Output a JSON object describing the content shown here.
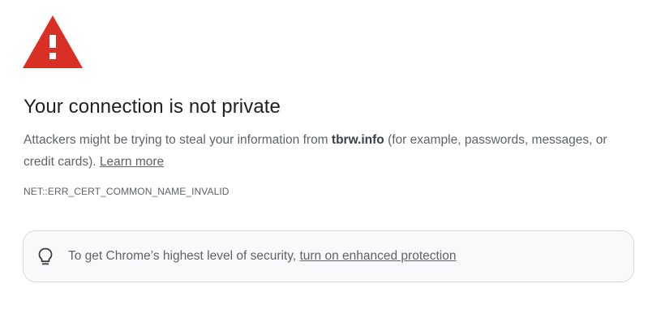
{
  "warning": {
    "icon": "warning-triangle-icon",
    "color": "#d93025"
  },
  "heading": "Your connection is not private",
  "explanation": {
    "prefix": "Attackers might be trying to steal your information from ",
    "domain": "tbrw.info",
    "suffix": " (for example, passwords, messages, or credit cards). ",
    "learn_more": "Learn more"
  },
  "error_code": "NET::ERR_CERT_COMMON_NAME_INVALID",
  "promo": {
    "icon": "lightbulb-icon",
    "text": "To get Chrome’s highest level of security, ",
    "link": "turn on enhanced protection"
  }
}
